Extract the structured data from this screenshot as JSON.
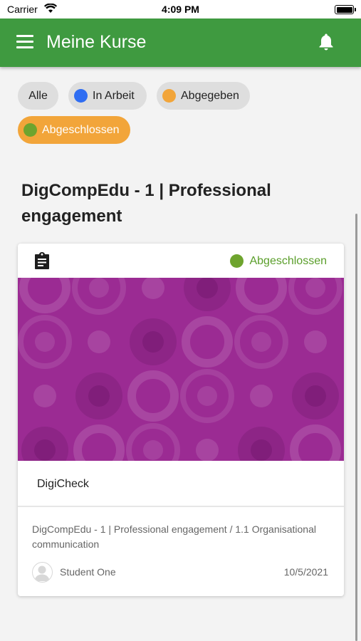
{
  "status_bar": {
    "carrier": "Carrier",
    "time": "4:09 PM"
  },
  "app_bar": {
    "title": "Meine Kurse",
    "icons": [
      "menu-icon",
      "bell-icon"
    ]
  },
  "filters": [
    {
      "label": "Alle",
      "dot_color": null,
      "active": false
    },
    {
      "label": "In Arbeit",
      "dot_color": "#2f6df2",
      "active": false
    },
    {
      "label": "Abgegeben",
      "dot_color": "#f2a53a",
      "active": false
    },
    {
      "label": "Abgeschlossen",
      "dot_color": "#6ea42e",
      "active": true
    }
  ],
  "course": {
    "title": "DigCompEdu - 1 | Professional engagement",
    "card": {
      "icon": "clipboard-icon",
      "status": "Abgeschlossen",
      "status_color": "#6ea42e",
      "banner_color": "#9b2b93",
      "activity": "DigiCheck",
      "path": "DigCompEdu - 1 | Professional engagement / 1.1 Organisational communication",
      "author": "Student One",
      "date": "10/5/2021"
    }
  },
  "colors": {
    "app_bar": "#3f9a40",
    "active_chip": "#f2a53a",
    "background": "#f3f3f3"
  }
}
